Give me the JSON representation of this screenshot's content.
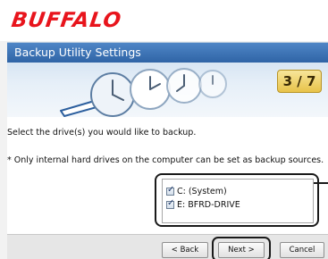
{
  "brand": {
    "logo_text": "BUFFALO",
    "logo_color": "#e8141c"
  },
  "banner": {
    "title": "Backup Utility Settings",
    "step": "3 / 7",
    "illustration": "clocks-and-arrow"
  },
  "content": {
    "instruction": "Select the drive(s) you would like to backup.",
    "note": "* Only internal hard drives on the computer can be set as backup sources."
  },
  "drives": [
    {
      "label": "C: (System)",
      "checked": true
    },
    {
      "label": "E: BFRD-DRIVE",
      "checked": true
    }
  ],
  "footer": {
    "back_label": "< Back",
    "next_label": "Next >",
    "cancel_label": "Cancel"
  },
  "colors": {
    "title_bar": "#2f64a6",
    "step_badge": "#e8c34a",
    "highlight": "#1a1a1a"
  }
}
